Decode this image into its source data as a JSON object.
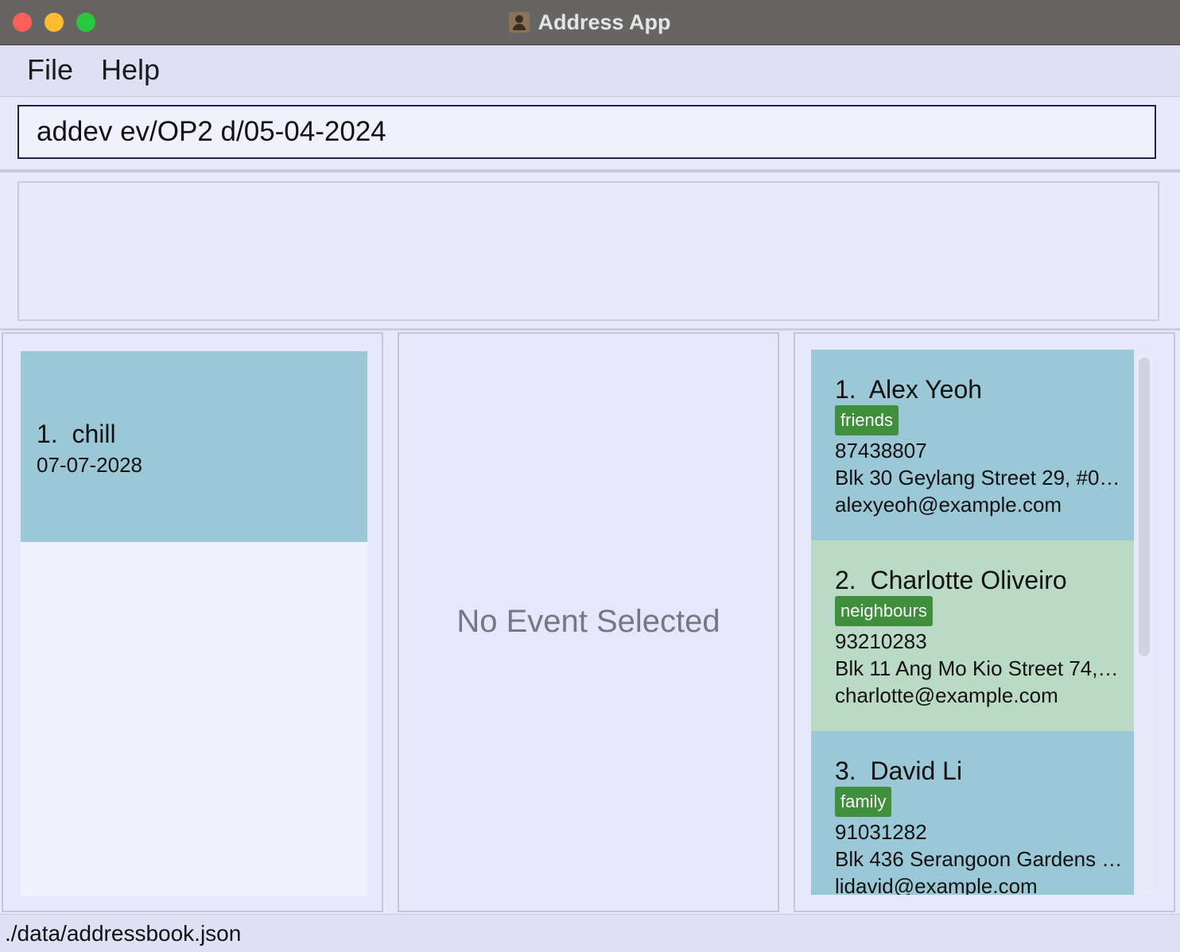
{
  "window": {
    "title": "Address App"
  },
  "menu": {
    "file": "File",
    "help": "Help"
  },
  "command": {
    "value": "addev ev/OP2 d/05-04-2024"
  },
  "result": {
    "text": ""
  },
  "events": [
    {
      "index": "1.",
      "name": "chill",
      "date": "07-07-2028"
    }
  ],
  "event_detail": {
    "placeholder": "No Event Selected"
  },
  "persons": [
    {
      "index": "1.",
      "name": "Alex Yeoh",
      "tag": "friends",
      "phone": "87438807",
      "address": "Blk 30 Geylang Street 29, #06-...",
      "email": "alexyeoh@example.com",
      "color": "#9ac8d7"
    },
    {
      "index": "2.",
      "name": "Charlotte Oliveiro",
      "tag": "neighbours",
      "phone": "93210283",
      "address": "Blk 11 Ang Mo Kio Street 74, #1...",
      "email": "charlotte@example.com",
      "color": "#badac5"
    },
    {
      "index": "3.",
      "name": "David Li",
      "tag": "family",
      "phone": "91031282",
      "address": "Blk 436 Serangoon Gardens St...",
      "email": "lidavid@example.com",
      "color": "#9ac8d7"
    }
  ],
  "status": {
    "path": "./data/addressbook.json"
  },
  "colors": {
    "tag": "#3f8f3c",
    "selected_card": "#9ac8d7",
    "alt_card": "#badac5"
  }
}
